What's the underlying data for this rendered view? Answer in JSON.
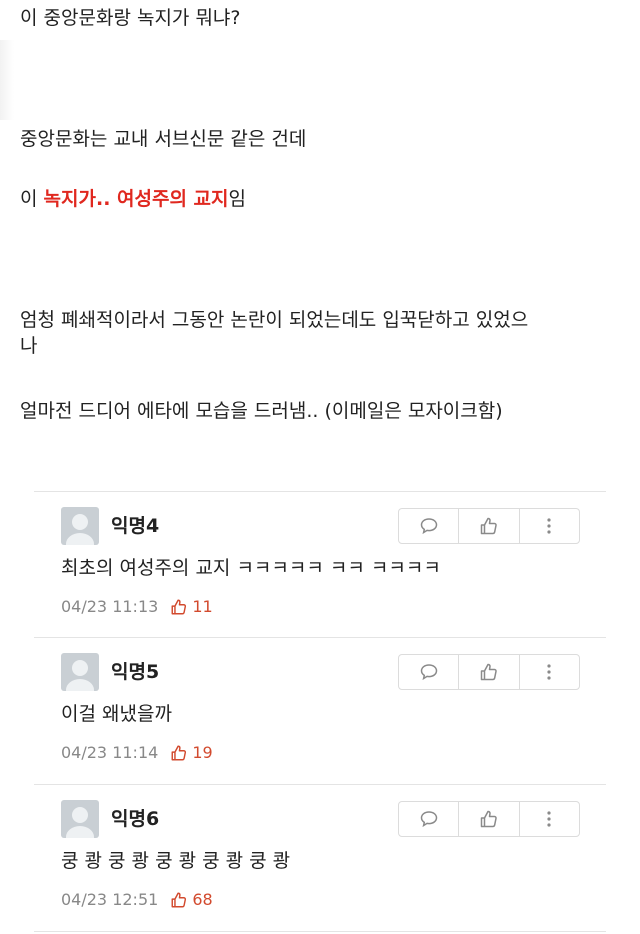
{
  "post": {
    "line1": "이 중앙문화랑 녹지가 뭐냐?",
    "line2": "중앙문화는 교내 서브신문 같은 건데",
    "line3_prefix": "이 ",
    "line3_highlight": "녹지가.. 여성주의 교지",
    "line3_suffix": "임",
    "line4": "엄청 폐쇄적이라서 그동안 논란이 되었는데도 입꾹닫하고 있었으",
    "line5": "나",
    "line6": "얼마전 드디어 에타에 모습을 드러냄.. (이메일은 모자이크함)"
  },
  "comments": [
    {
      "nickname": "익명4",
      "text": "최초의 여성주의 교지 ㅋㅋㅋㅋㅋ ㅋㅋ ㅋㅋㅋㅋ",
      "time": "04/23 11:13",
      "likes": "11"
    },
    {
      "nickname": "익명5",
      "text": "이걸 왜냈을까",
      "time": "04/23 11:14",
      "likes": "19"
    },
    {
      "nickname": "익명6",
      "text": "쿵 쾅 쿵 쾅 쿵 쾅 쿵 쾅 쿵 쾅",
      "time": "04/23 12:51",
      "likes": "68"
    }
  ],
  "icons": {
    "reply": "speech-bubble-icon",
    "vote": "thumbs-up-icon",
    "more": "more-vertical-icon",
    "avatar": "default-avatar-icon"
  },
  "colors": {
    "highlight": "#e0281f",
    "like": "#d24a2e",
    "meta": "#888888"
  }
}
